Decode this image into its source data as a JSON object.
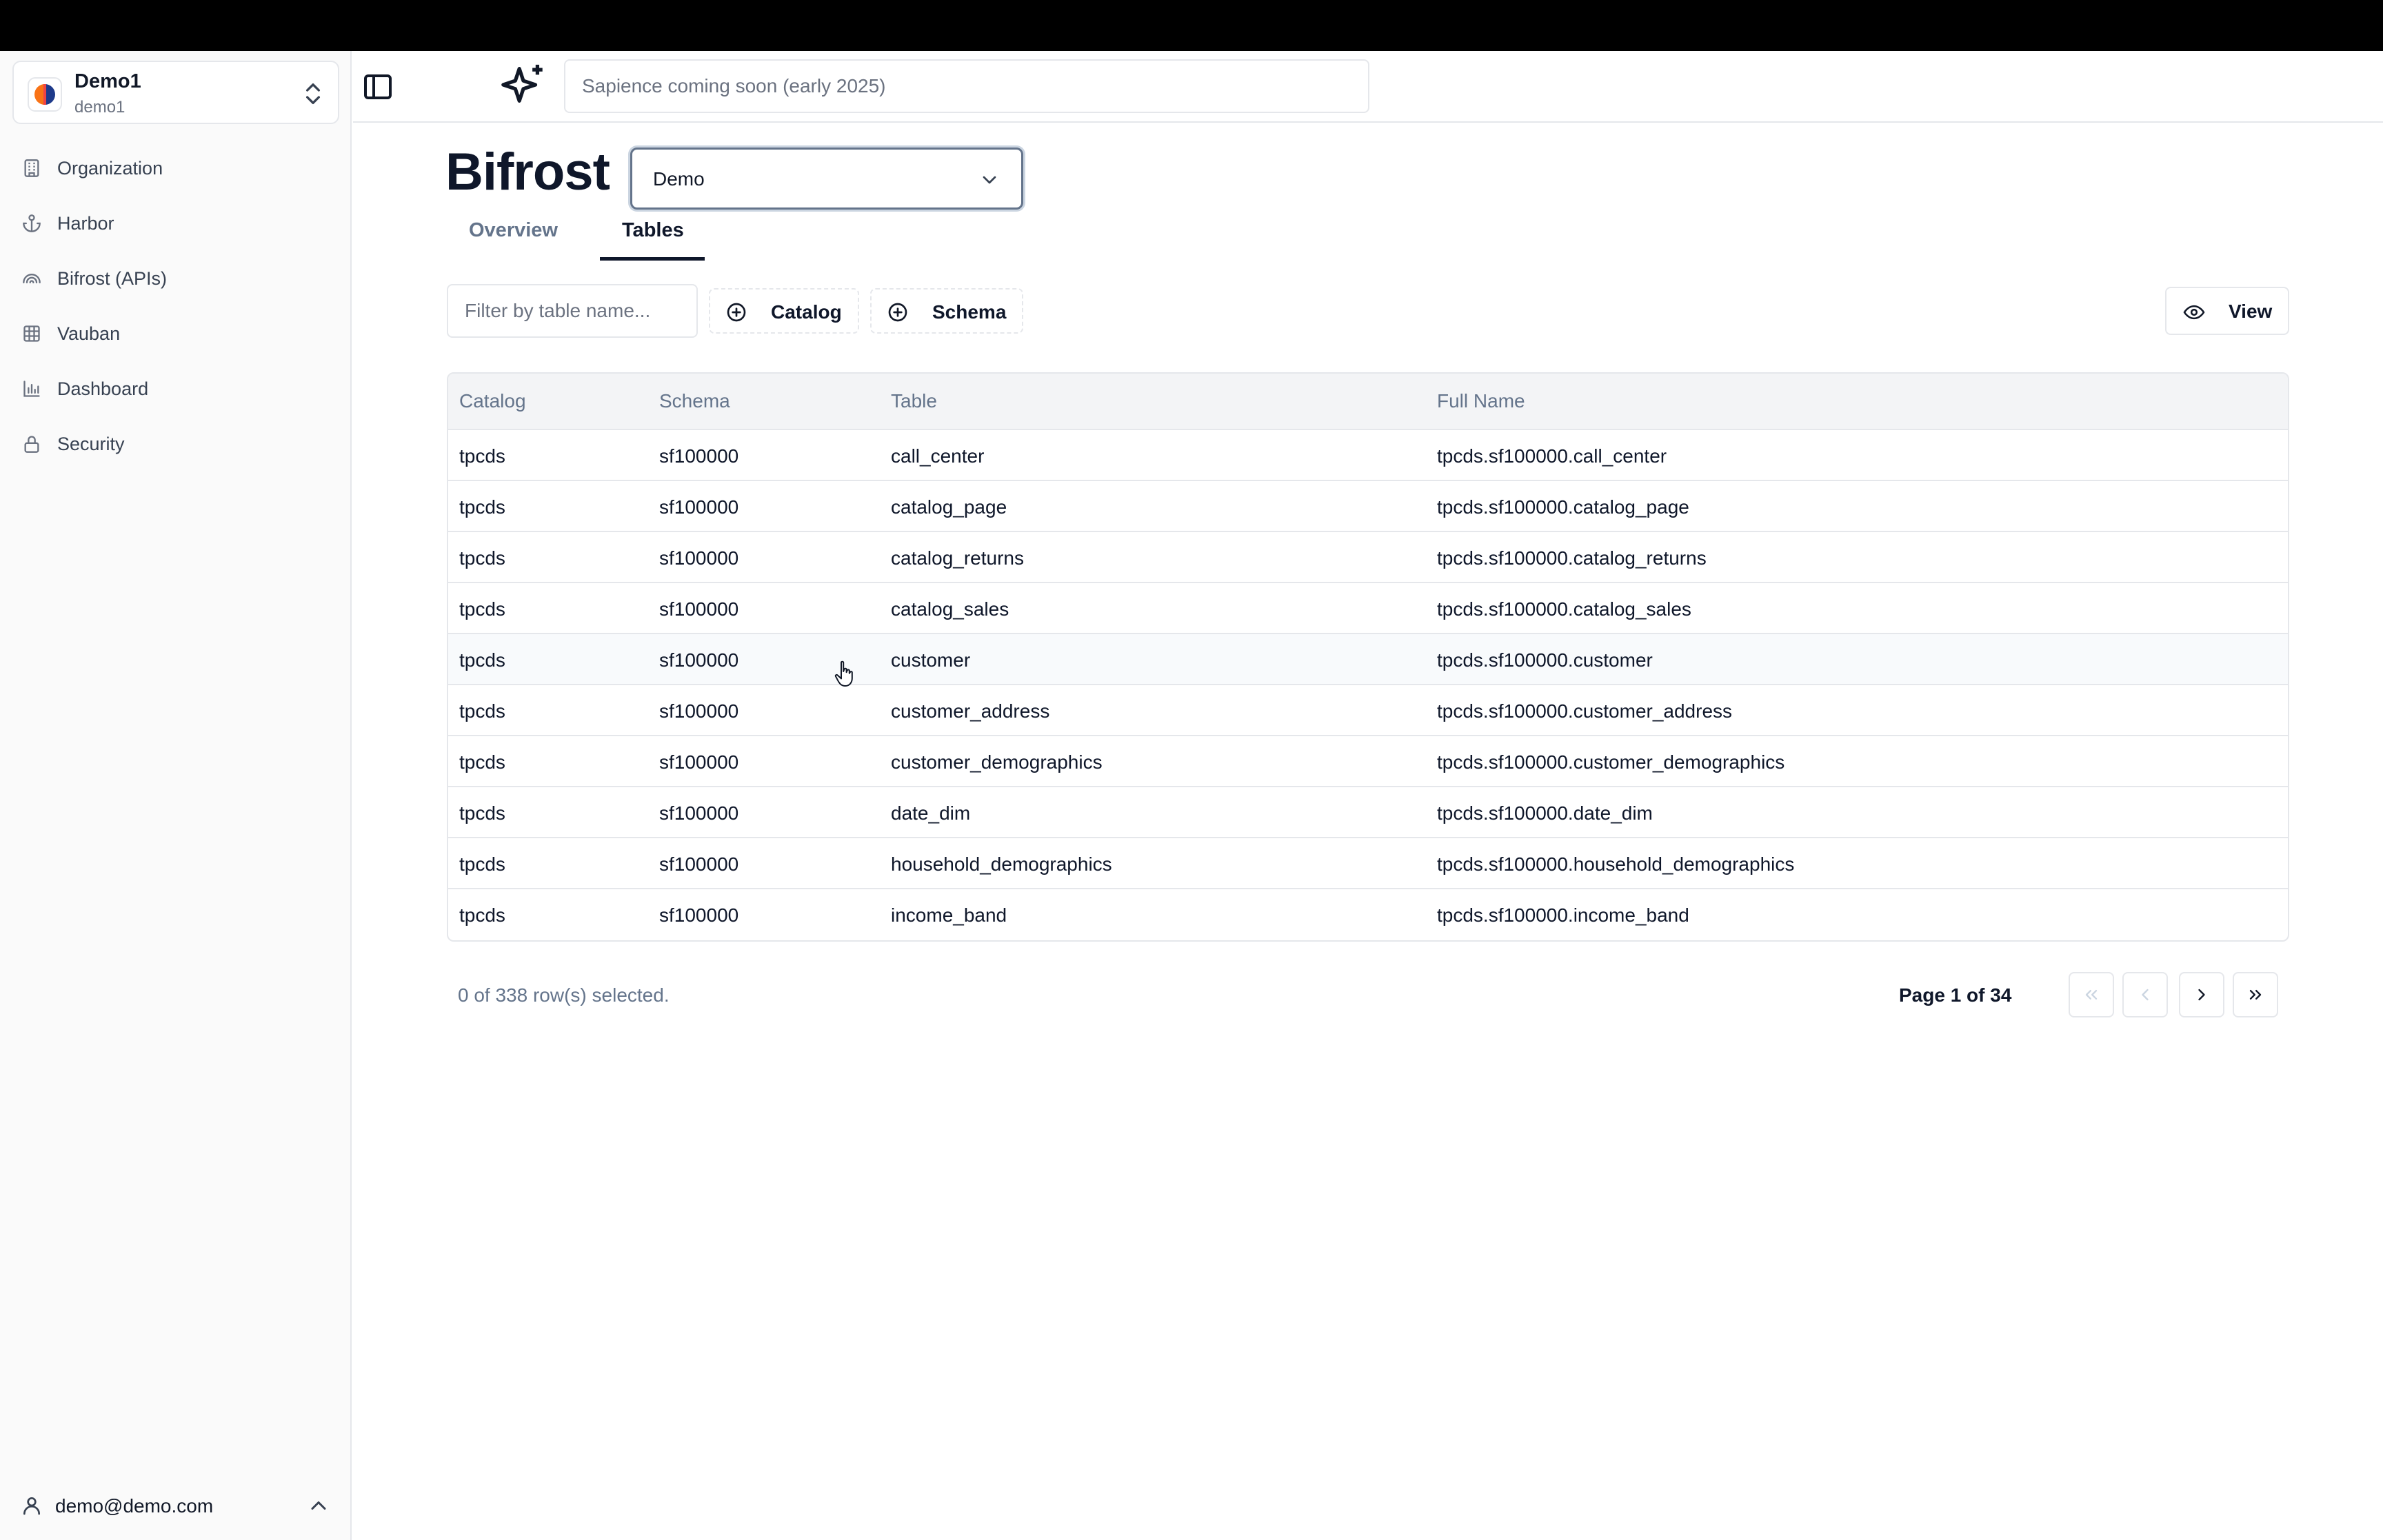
{
  "org": {
    "name": "Demo1",
    "slug": "demo1"
  },
  "sidebar": {
    "items": [
      {
        "label": "Organization",
        "icon": "building-icon"
      },
      {
        "label": "Harbor",
        "icon": "anchor-icon"
      },
      {
        "label": "Bifrost (APIs)",
        "icon": "rainbow-icon"
      },
      {
        "label": "Vauban",
        "icon": "grid-icon"
      },
      {
        "label": "Dashboard",
        "icon": "bar-chart-icon"
      },
      {
        "label": "Security",
        "icon": "lock-icon"
      }
    ],
    "user_email": "demo@demo.com"
  },
  "header": {
    "sapience_placeholder": "Sapience coming soon (early 2025)"
  },
  "page": {
    "title": "Bifrost",
    "environment": "Demo",
    "tabs": [
      {
        "label": "Overview",
        "active": false
      },
      {
        "label": "Tables",
        "active": true
      }
    ]
  },
  "toolbar": {
    "filter_placeholder": "Filter by table name...",
    "catalog_label": "Catalog",
    "schema_label": "Schema",
    "view_label": "View"
  },
  "table": {
    "columns": [
      "Catalog",
      "Schema",
      "Table",
      "Full Name"
    ],
    "rows": [
      [
        "tpcds",
        "sf100000",
        "call_center",
        "tpcds.sf100000.call_center"
      ],
      [
        "tpcds",
        "sf100000",
        "catalog_page",
        "tpcds.sf100000.catalog_page"
      ],
      [
        "tpcds",
        "sf100000",
        "catalog_returns",
        "tpcds.sf100000.catalog_returns"
      ],
      [
        "tpcds",
        "sf100000",
        "catalog_sales",
        "tpcds.sf100000.catalog_sales"
      ],
      [
        "tpcds",
        "sf100000",
        "customer",
        "tpcds.sf100000.customer"
      ],
      [
        "tpcds",
        "sf100000",
        "customer_address",
        "tpcds.sf100000.customer_address"
      ],
      [
        "tpcds",
        "sf100000",
        "customer_demographics",
        "tpcds.sf100000.customer_demographics"
      ],
      [
        "tpcds",
        "sf100000",
        "date_dim",
        "tpcds.sf100000.date_dim"
      ],
      [
        "tpcds",
        "sf100000",
        "household_demographics",
        "tpcds.sf100000.household_demographics"
      ],
      [
        "tpcds",
        "sf100000",
        "income_band",
        "tpcds.sf100000.income_band"
      ]
    ]
  },
  "footer": {
    "selection": "0 of 338 row(s) selected.",
    "page": "Page 1 of 34"
  },
  "colors": {
    "accent": "#0f172a",
    "muted": "#64748b",
    "border": "#e5e7eb",
    "sidebar_bg": "#fafafa"
  }
}
